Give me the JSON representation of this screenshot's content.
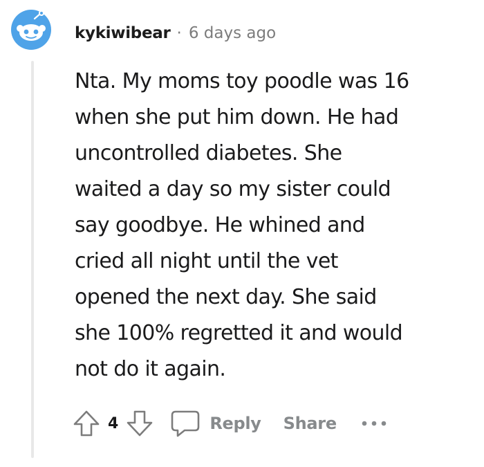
{
  "comment": {
    "username": "kykiwibear",
    "separator": "·",
    "timestamp": "6 days ago",
    "text": "Nta. My moms toy poodle was 16\nwhen she put him down. He had\nuncontrolled diabetes. She\nwaited a day so my sister could\nsay goodbye. He whined and\ncried all night until the vet\nopened the next day. She said\nshe 100% regretted it and would\nnot do it again."
  },
  "actions": {
    "vote_count": "4",
    "reply_label": "Reply",
    "share_label": "Share",
    "more_icon": "more-horizontal-icon"
  },
  "icons": {
    "avatar": "snoo-avatar-icon",
    "upvote": "upvote-arrow-icon",
    "downvote": "downvote-arrow-icon",
    "reply": "speech-bubble-icon"
  },
  "colors": {
    "avatar_blue": "#4fa3e8",
    "avatar_face": "#ffffff",
    "muted_text": "#7c7c7c",
    "action_gray": "#878a8c",
    "thread_line": "#e8e8e8",
    "body_text": "#1a1a1b"
  }
}
